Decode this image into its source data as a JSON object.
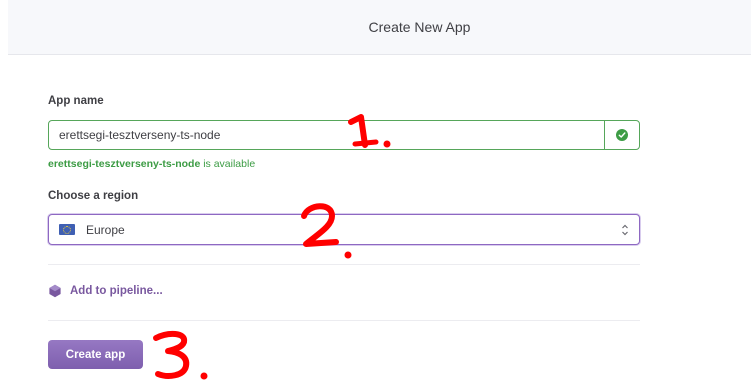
{
  "header": {
    "title": "Create New App"
  },
  "form": {
    "app_name_label": "App name",
    "app_name_value": "erettsegi-tesztverseny-ts-node",
    "availability_name": "erettsegi-tesztverseny-ts-node",
    "availability_suffix": " is available",
    "region_label": "Choose a region",
    "region_value": "Europe",
    "pipeline_link": "Add to pipeline...",
    "create_button": "Create app"
  },
  "annotations": [
    "1.",
    "2.",
    "3."
  ],
  "colors": {
    "accent": "#79589f",
    "success": "#3d9c45",
    "annotation": "#ff0000"
  }
}
